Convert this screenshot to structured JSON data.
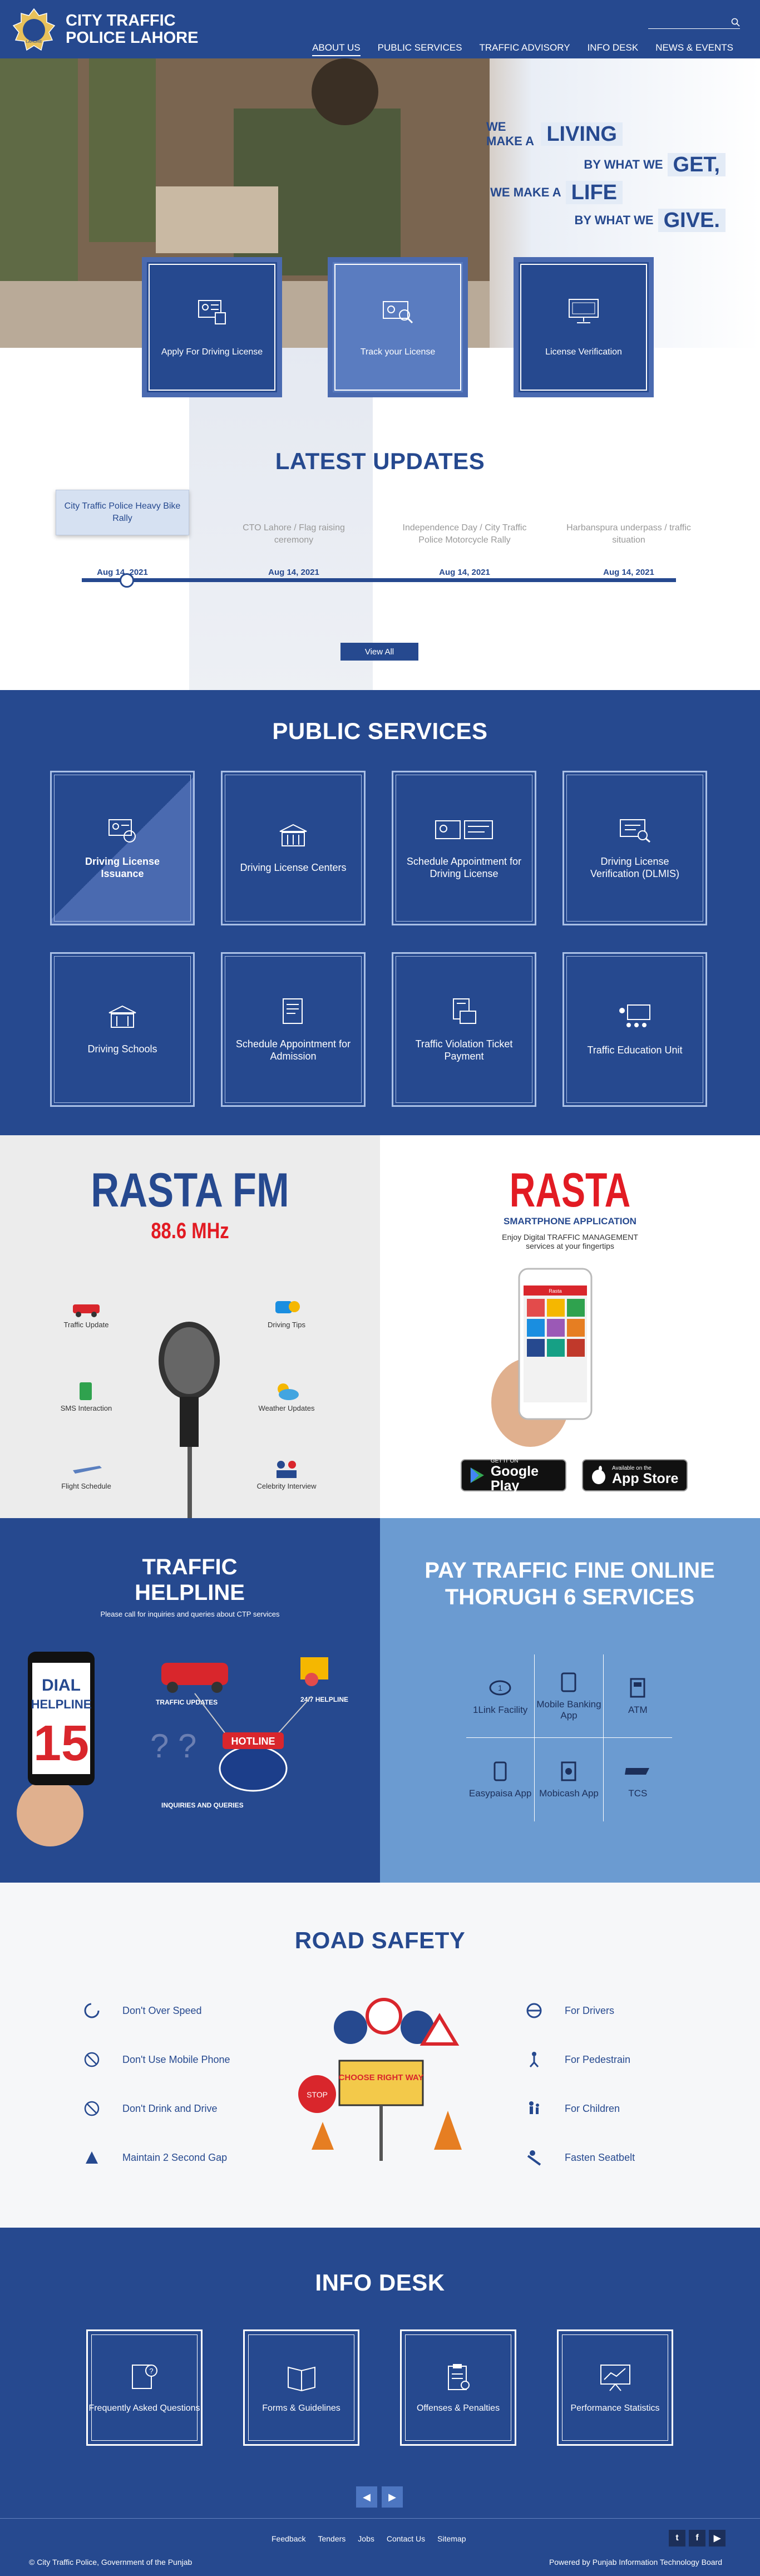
{
  "header": {
    "brand_line1": "City Traffic",
    "brand_line2": "Police Lahore",
    "logo_text": "LAHORE",
    "search": {
      "placeholder": ""
    },
    "menu": [
      {
        "label": "About Us"
      },
      {
        "label": "Public Services"
      },
      {
        "label": "Traffic Advisory"
      },
      {
        "label": "Info Desk"
      },
      {
        "label": "News & Events"
      }
    ]
  },
  "hero": {
    "slogan": [
      {
        "small": "WE MAKE A",
        "big": "LIVING"
      },
      {
        "small": "BY WHAT WE",
        "big": "GET,"
      },
      {
        "small": "WE MAKE A",
        "big": "LIFE"
      },
      {
        "small": "BY WHAT WE",
        "big": "GIVE."
      }
    ],
    "cards": [
      {
        "label": "Apply For Driving License",
        "icon": "license-icon"
      },
      {
        "label": "Track your License",
        "icon": "track-license-icon"
      },
      {
        "label": "License Verification",
        "icon": "computer-monitor-icon"
      }
    ]
  },
  "updates": {
    "title": "LATEST UPDATES",
    "items": [
      {
        "title": "City Traffic Police Heavy Bike Rally",
        "date": "Aug 14, 2021"
      },
      {
        "title": "CTO Lahore / Flag raising ceremony",
        "date": "Aug 14, 2021"
      },
      {
        "title": "Independence Day / City Traffic Police Motorcycle Rally",
        "date": "Aug 14, 2021"
      },
      {
        "title": "Harbanspura underpass / traffic situation",
        "date": "Aug 14, 2021"
      }
    ],
    "view_all": "View All"
  },
  "services": {
    "title": "PUBLIC SERVICES",
    "items": [
      {
        "label": "Driving License Issuance",
        "icon": "license-icon"
      },
      {
        "label": "Driving License Centers",
        "icon": "building-icon"
      },
      {
        "label": "Schedule Appointment for Driving License",
        "icon": "id-card-icon"
      },
      {
        "label": "Driving License Verification (DLMIS)",
        "icon": "license-verify-icon"
      },
      {
        "label": "Driving Schools",
        "icon": "school-icon"
      },
      {
        "label": "Schedule Appointment for Admission",
        "icon": "document-icon"
      },
      {
        "label": "Traffic Violation Ticket Payment",
        "icon": "payment-icon"
      },
      {
        "label": "Traffic Education Unit",
        "icon": "classroom-icon"
      }
    ]
  },
  "rasta_fm": {
    "title": "RASTA FM",
    "freq": "88.6 MHz",
    "features": [
      "Traffic Update",
      "Driving Tips",
      "SMS Interaction",
      "Weather Updates",
      "Flight Schedule",
      "Celebrity Interview"
    ]
  },
  "rasta_app": {
    "title": "RASTA",
    "subtitle": "SMARTPHONE APPLICATION",
    "desc": "Enjoy Digital TRAFFIC MANAGEMENT services at your fingertips",
    "phone_title": "Rasta",
    "google": {
      "small": "GET IT ON",
      "big": "Google Play"
    },
    "apple": {
      "small": "Available on the",
      "big": "App Store"
    }
  },
  "helpline": {
    "title": "TRAFFIC HELPLINE",
    "desc": "Please call for inquiries and queries about CTP services",
    "dial": "DIAL",
    "helpline_word": "HELPLINE",
    "number": "15",
    "labels": [
      "TRAFFIC UPDATES",
      "24/7 HELPLINE",
      "HOTLINE",
      "INQUIRIES AND QUERIES"
    ]
  },
  "payfine": {
    "title": "PAY TRAFFIC FINE ONLINE THORUGH 6 SERVICES",
    "items": [
      {
        "label": "1Link Facility"
      },
      {
        "label": "Mobile Banking App"
      },
      {
        "label": "ATM"
      },
      {
        "label": "Easypaisa App"
      },
      {
        "label": "Mobicash App"
      },
      {
        "label": "TCS"
      }
    ]
  },
  "road": {
    "title": "ROAD SAFETY",
    "left": [
      "Don't Over Speed",
      "Don't Use Mobile Phone",
      "Don't Drink and Drive",
      "Maintain 2 Second Gap"
    ],
    "right": [
      "For Drivers",
      "For Pedestrain",
      "For Children",
      "Fasten Seatbelt"
    ],
    "sign_text": "CHOOSE RIGHT WAY",
    "stop": "STOP"
  },
  "info": {
    "title": "INFO DESK",
    "items": [
      {
        "label": "Frequently Asked Questions"
      },
      {
        "label": "Forms & Guidelines"
      },
      {
        "label": "Offenses & Penalties"
      },
      {
        "label": "Performance Statistics"
      }
    ],
    "prev": "◀",
    "next": "▶"
  },
  "footer": {
    "links": [
      "Feedback",
      "Tenders",
      "Jobs",
      "Contact Us",
      "Sitemap"
    ],
    "copyright": "© City Traffic Police, Government of the Punjab",
    "powered": "Powered by Punjab Information Technology Board",
    "social": [
      "t",
      "f",
      "▶"
    ]
  }
}
